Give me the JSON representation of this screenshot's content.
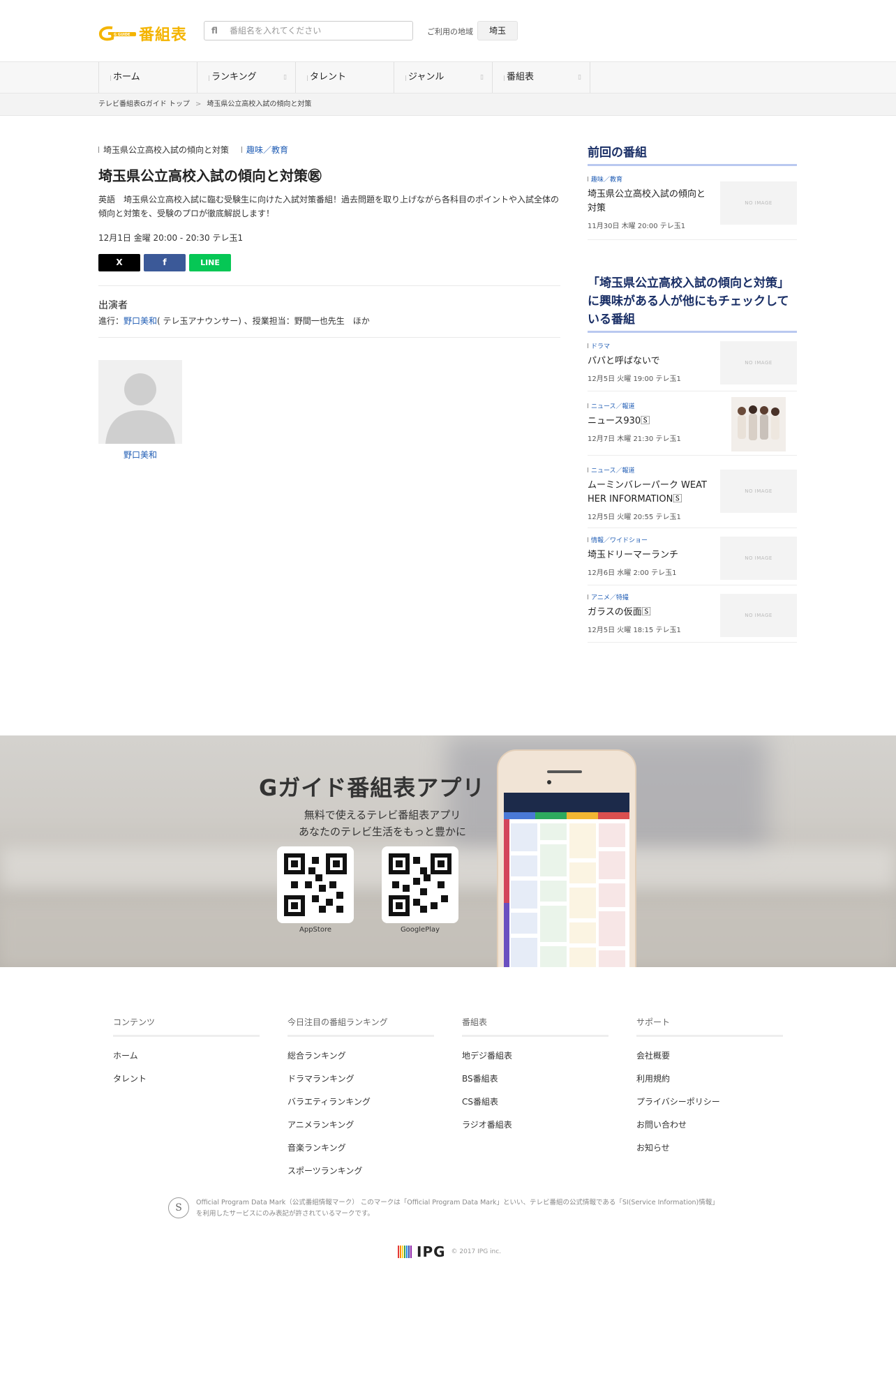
{
  "header": {
    "logo_text": "番組表",
    "logo_badge": "G GUIDE",
    "search_placeholder": "番組名を入れてください",
    "region_label": "ご利用の地域",
    "region_value": "埼玉"
  },
  "nav": {
    "items": [
      {
        "label": "ホーム"
      },
      {
        "label": "ランキング"
      },
      {
        "label": "タレント"
      },
      {
        "label": "ジャンル"
      },
      {
        "label": "番組表"
      }
    ]
  },
  "breadcrumb": {
    "home": "テレビ番組表Gガイド トップ",
    "separator": ">",
    "current": "埼玉県公立高校入試の傾向と対策"
  },
  "program": {
    "series": "埼玉県公立高校入試の傾向と対策",
    "genre": "趣味／教育",
    "title": "埼玉県公立高校入試の傾向と対策㊩",
    "description": "英語　埼玉県公立高校入試に臨む受験生に向けた入試対策番組！過去問題を取り上げながら各科目のポイントや入試全体の傾向と対策を、受験のプロが徹底解説します！",
    "time": "12月1日 金曜 20:00  - 20:30 テレ玉1",
    "share": {
      "x": "X",
      "facebook": "f",
      "line": "LINE"
    },
    "cast_heading": "出演者",
    "cast_prefix": "進行：",
    "cast_link": "野口美和",
    "cast_suffix": "( テレ玉アナウンサー) 、授業担当：野間一也先生　ほか",
    "talent_name": "野口美和"
  },
  "sidebar": {
    "previous_heading": "前回の番組",
    "previous": {
      "genre": "趣味／教育",
      "title": "埼玉県公立高校入試の傾向と対策",
      "date": "11月30日 木曜 20:00 テレ玉1",
      "thumb": "NO IMAGE"
    },
    "related_heading": "「埼玉県公立高校入試の傾向と対策」に興味がある人が他にもチェックしている番組",
    "related": [
      {
        "genre": "ドラマ",
        "title": "パパと呼ばないで",
        "date": "12月5日 火曜 19:00 テレ玉1",
        "thumb": "NO IMAGE"
      },
      {
        "genre": "ニュース／報道",
        "title": "ニュース930🅂",
        "date": "12月7日 木曜 21:30 テレ玉1",
        "thumb": "photo"
      },
      {
        "genre": "ニュース／報道",
        "title": "ムーミンバレーパーク WEATHER INFORMATION🅂",
        "date": "12月5日 火曜 20:55 テレ玉1",
        "thumb": "NO IMAGE"
      },
      {
        "genre": "情報／ワイドショー",
        "title": "埼玉ドリーマーランチ",
        "date": "12月6日 水曜 2:00 テレ玉1",
        "thumb": "NO IMAGE"
      },
      {
        "genre": "アニメ／特撮",
        "title": "ガラスの仮面🅂",
        "date": "12月5日 火曜 18:15 テレ玉1",
        "thumb": "NO IMAGE"
      }
    ]
  },
  "app_banner": {
    "title": "Gガイド番組表アプリ",
    "line1": "無料で使えるテレビ番組表アプリ",
    "line2": "あなたのテレビ生活をもっと豊かに",
    "appstore": "AppStore",
    "googleplay": "GooglePlay"
  },
  "footer": {
    "columns": [
      {
        "heading": "コンテンツ",
        "links": [
          "ホーム",
          "タレント"
        ]
      },
      {
        "heading": "今日注目の番組ランキング",
        "links": [
          "総合ランキング",
          "ドラマランキング",
          "バラエティランキング",
          "アニメランキング",
          "音楽ランキング",
          "スポーツランキング"
        ]
      },
      {
        "heading": "番組表",
        "links": [
          "地デジ番組表",
          "BS番組表",
          "CS番組表",
          "ラジオ番組表"
        ]
      },
      {
        "heading": "サポート",
        "links": [
          "会社概要",
          "利用規約",
          "プライバシーポリシー",
          "お問い合わせ",
          "お知らせ"
        ]
      }
    ],
    "opdm_line1": "Official Program Data Mark（公式番組情報マーク） このマークは「Official Program Data Mark」といい、テレビ番組の公式情報である「SI(Service Information)情報」",
    "opdm_line2": "を利用したサービスにのみ表記が許されているマークです。",
    "opdm_seal": "S",
    "ipg_word": "IPG",
    "copyright": "© 2017 IPG inc."
  },
  "colors": {
    "brand_yellow": "#f4b400",
    "link_blue": "#1f5cb4",
    "heading_navy": "#1a2f66",
    "line_green": "#06c755",
    "facebook_blue": "#3b5998"
  }
}
